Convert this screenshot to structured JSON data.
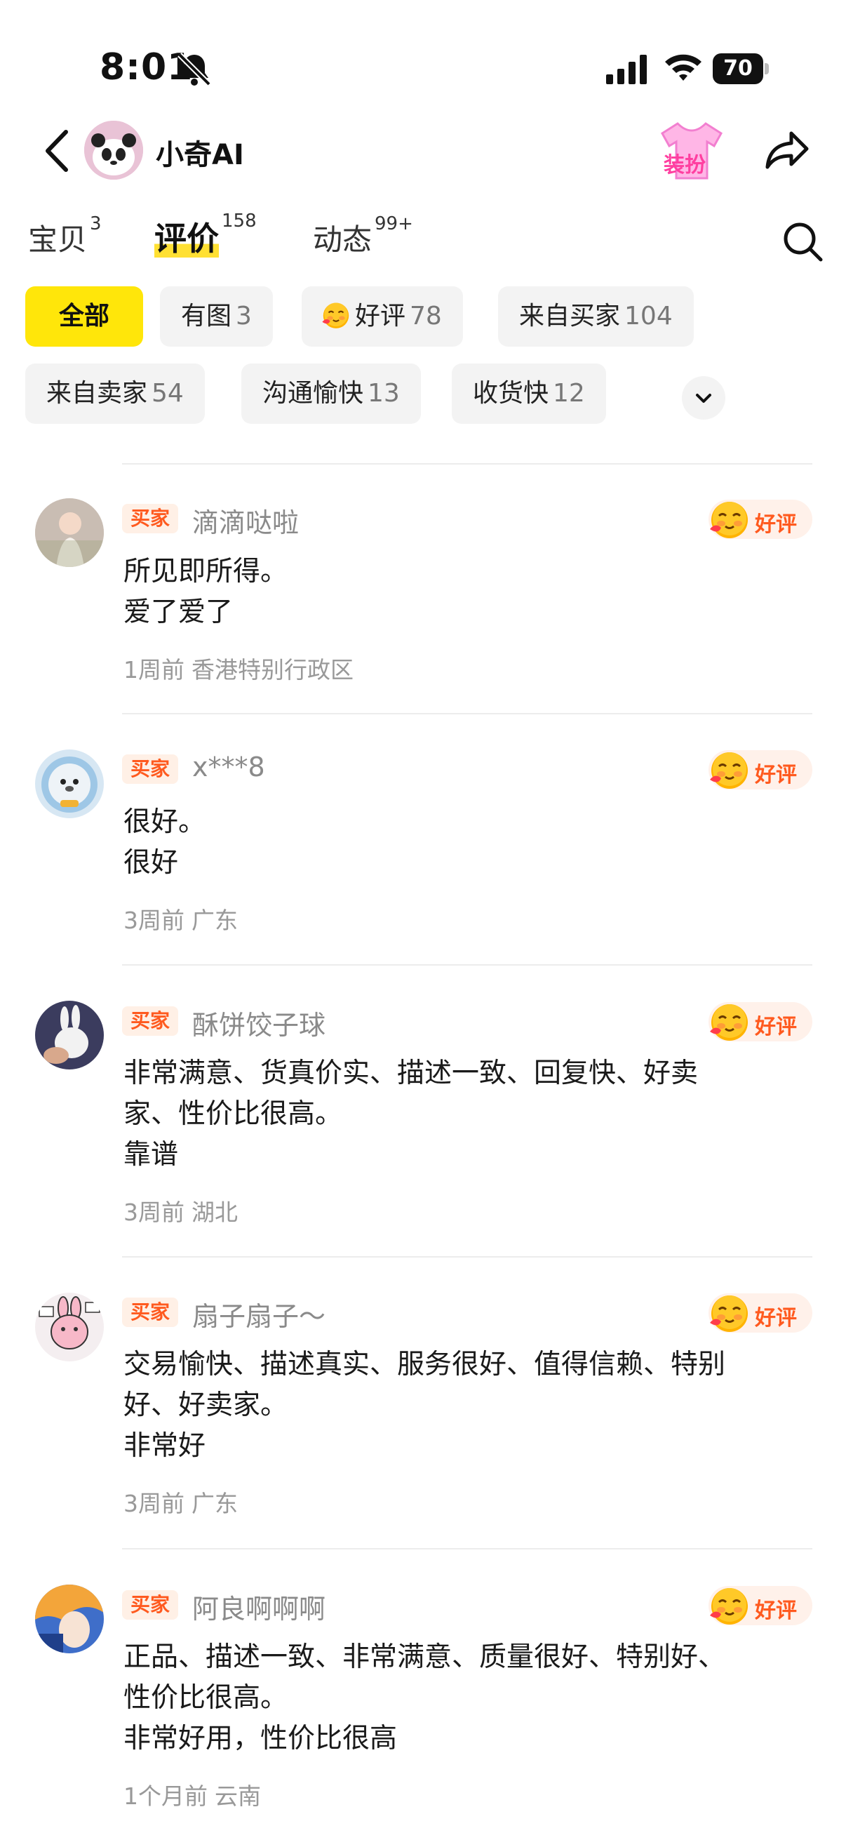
{
  "status_bar": {
    "time": "8:01",
    "battery": "70"
  },
  "header": {
    "shop_name": "小奇AI",
    "dress_label": "装扮"
  },
  "tabs": [
    {
      "label": "宝贝",
      "count": "3"
    },
    {
      "label": "评价",
      "count": "158"
    },
    {
      "label": "动态",
      "count": "99+"
    }
  ],
  "filters": [
    {
      "label": "全部",
      "count": ""
    },
    {
      "label": "有图",
      "count": "3"
    },
    {
      "label": "好评",
      "count": "78"
    },
    {
      "label": "来自买家",
      "count": "104"
    },
    {
      "label": "来自卖家",
      "count": "54"
    },
    {
      "label": "沟通愉快",
      "count": "13"
    },
    {
      "label": "收货快",
      "count": "12"
    }
  ],
  "badges": {
    "buyer": "买家",
    "good": "好评"
  },
  "reviews": [
    {
      "name": "滴滴哒啦",
      "line1": "所见即所得。",
      "line2": "爱了爱了",
      "line3": "",
      "time": "1周前",
      "region": "香港特别行政区"
    },
    {
      "name": "x***8",
      "line1": "很好。",
      "line2": "很好",
      "line3": "",
      "time": "3周前",
      "region": "广东"
    },
    {
      "name": "酥饼饺子球",
      "line1": "非常满意、货真价实、描述一致、回复快、好卖",
      "line2": "家、性价比很高。",
      "line3": "靠谱",
      "time": "3周前",
      "region": "湖北"
    },
    {
      "name": "扇子扇子～",
      "line1": "交易愉快、描述真实、服务很好、值得信赖、特别",
      "line2": "好、好卖家。",
      "line3": "非常好",
      "time": "3周前",
      "region": "广东"
    },
    {
      "name": "阿良啊啊啊",
      "line1": "正品、描述一致、非常满意、质量很好、特别好、",
      "line2": "性价比很高。",
      "line3": "非常好用，性价比很高",
      "time": "1个月前",
      "region": "云南"
    }
  ]
}
